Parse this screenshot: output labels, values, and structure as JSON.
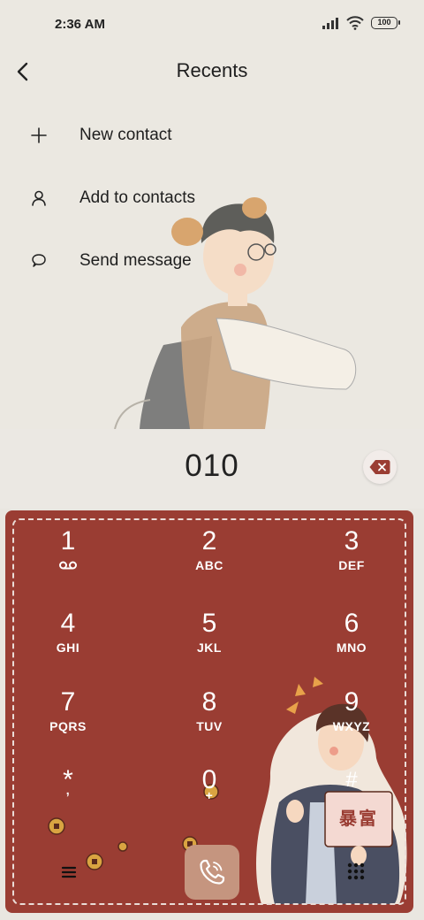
{
  "status": {
    "time": "2:36 AM",
    "battery": "100"
  },
  "header": {
    "title": "Recents"
  },
  "menu": [
    {
      "label": "New contact",
      "icon": "plus-icon"
    },
    {
      "label": "Add to contacts",
      "icon": "person-icon"
    },
    {
      "label": "Send message",
      "icon": "chat-bubble-icon"
    }
  ],
  "dialer": {
    "number": "010"
  },
  "keys": [
    {
      "digit": "1",
      "letters": ""
    },
    {
      "digit": "2",
      "letters": "ABC"
    },
    {
      "digit": "3",
      "letters": "DEF"
    },
    {
      "digit": "4",
      "letters": "GHI"
    },
    {
      "digit": "5",
      "letters": "JKL"
    },
    {
      "digit": "6",
      "letters": "MNO"
    },
    {
      "digit": "7",
      "letters": "PQRS"
    },
    {
      "digit": "8",
      "letters": "TUV"
    },
    {
      "digit": "9",
      "letters": "WXYZ"
    },
    {
      "digit": "*",
      "letters": ","
    },
    {
      "digit": "0",
      "letters": "+"
    },
    {
      "digit": "#",
      "letters": ""
    }
  ],
  "sign": {
    "text": "暴富"
  },
  "colors": {
    "keypad": "#9a3d33",
    "call": "#c5957f",
    "background": "#ebe8e1"
  }
}
